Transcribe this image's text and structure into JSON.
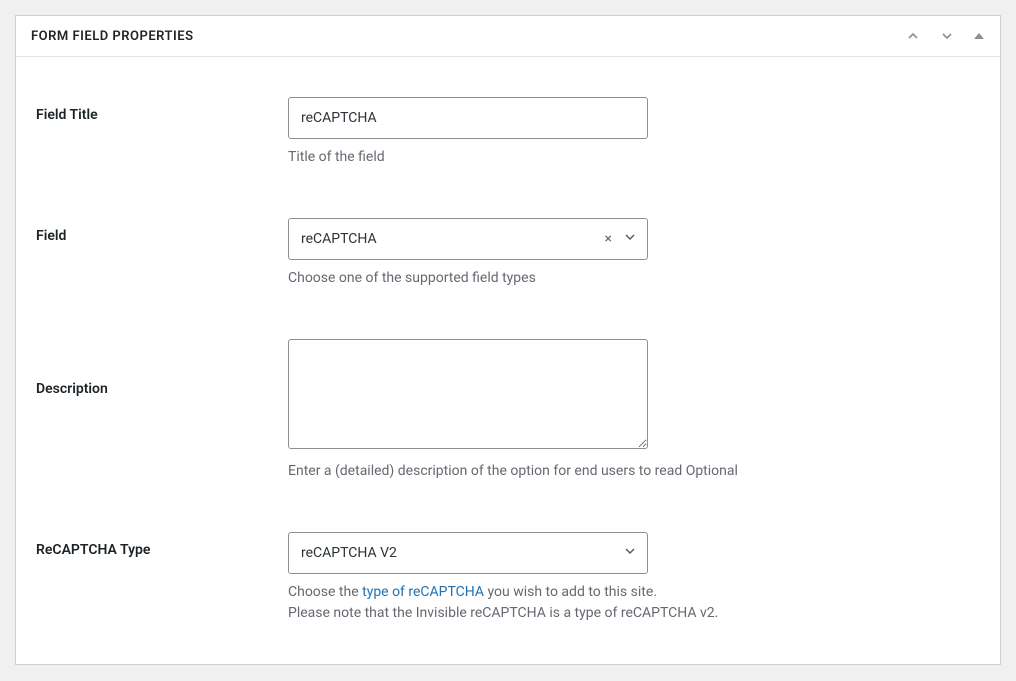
{
  "panel": {
    "title": "FORM FIELD PROPERTIES"
  },
  "fields": {
    "fieldTitle": {
      "label": "Field Title",
      "value": "reCAPTCHA",
      "help": "Title of the field"
    },
    "field": {
      "label": "Field",
      "value": "reCAPTCHA",
      "help": "Choose one of the supported field types"
    },
    "description": {
      "label": "Description",
      "value": "",
      "help": "Enter a (detailed) description of the option for end users to read Optional"
    },
    "recaptchaType": {
      "label": "ReCAPTCHA Type",
      "value": "reCAPTCHA V2",
      "helpPrefix": "Choose the ",
      "helpLink": "type of reCAPTCHA",
      "helpSuffix": " you wish to add to this site.",
      "helpNote": "Please note that the Invisible reCAPTCHA is a type of reCAPTCHA v2."
    }
  }
}
